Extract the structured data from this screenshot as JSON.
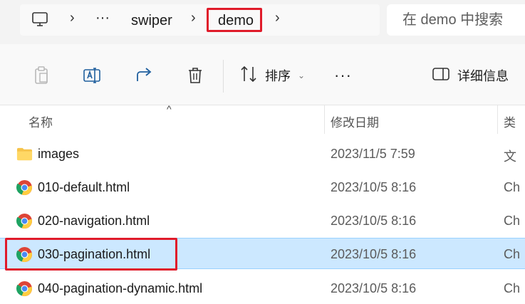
{
  "address": {
    "crumbs": [
      "···",
      "swiper",
      "demo"
    ],
    "search_placeholder": "在 demo 中搜索"
  },
  "toolbar": {
    "sort_label": "排序",
    "more_label": "···",
    "details_label": "详细信息"
  },
  "columns": {
    "name": "名称",
    "date": "修改日期",
    "type": "类"
  },
  "files": [
    {
      "name": "images",
      "date": "2023/11/5 7:59",
      "type": "文",
      "icon": "folder-icon",
      "selected": false
    },
    {
      "name": "010-default.html",
      "date": "2023/10/5 8:16",
      "type": "Ch",
      "icon": "chrome-icon",
      "selected": false
    },
    {
      "name": "020-navigation.html",
      "date": "2023/10/5 8:16",
      "type": "Ch",
      "icon": "chrome-icon",
      "selected": false
    },
    {
      "name": "030-pagination.html",
      "date": "2023/10/5 8:16",
      "type": "Ch",
      "icon": "chrome-icon",
      "selected": true
    },
    {
      "name": "040-pagination-dynamic.html",
      "date": "2023/10/5 8:16",
      "type": "Ch",
      "icon": "chrome-icon",
      "selected": false
    }
  ],
  "colors": {
    "highlight": "#e01b2a",
    "selection": "#cce8ff"
  }
}
